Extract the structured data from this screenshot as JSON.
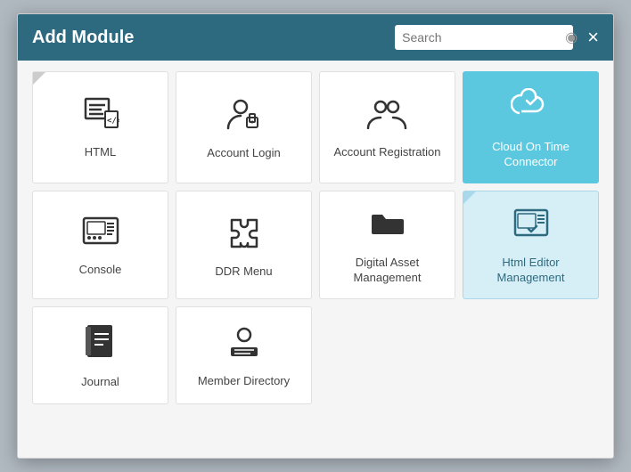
{
  "modal": {
    "title": "Add Module",
    "close_label": "×",
    "search": {
      "placeholder": "Search",
      "value": ""
    }
  },
  "modules": [
    {
      "id": "html",
      "label": "HTML",
      "icon": "html",
      "selected": false,
      "flagged": true
    },
    {
      "id": "account-login",
      "label": "Account Login",
      "icon": "account-login",
      "selected": false,
      "flagged": false
    },
    {
      "id": "account-registration",
      "label": "Account Registration",
      "icon": "account-registration",
      "selected": false,
      "flagged": false
    },
    {
      "id": "cloud-on-time",
      "label": "Cloud On Time Connector",
      "icon": "cloud-on-time",
      "selected": true,
      "flagged": false
    },
    {
      "id": "console",
      "label": "Console",
      "icon": "console",
      "selected": false,
      "flagged": false
    },
    {
      "id": "ddr-menu",
      "label": "DDR Menu",
      "icon": "ddr-menu",
      "selected": false,
      "flagged": false
    },
    {
      "id": "digital-asset",
      "label": "Digital Asset Management",
      "icon": "digital-asset",
      "selected": false,
      "flagged": false
    },
    {
      "id": "html-editor",
      "label": "Html Editor Management",
      "icon": "html-editor",
      "selected": false,
      "selectedLight": true,
      "flagged": true
    },
    {
      "id": "journal",
      "label": "Journal",
      "icon": "journal",
      "selected": false,
      "flagged": false
    },
    {
      "id": "member-directory",
      "label": "Member Directory",
      "icon": "member-directory",
      "selected": false,
      "flagged": false
    }
  ]
}
